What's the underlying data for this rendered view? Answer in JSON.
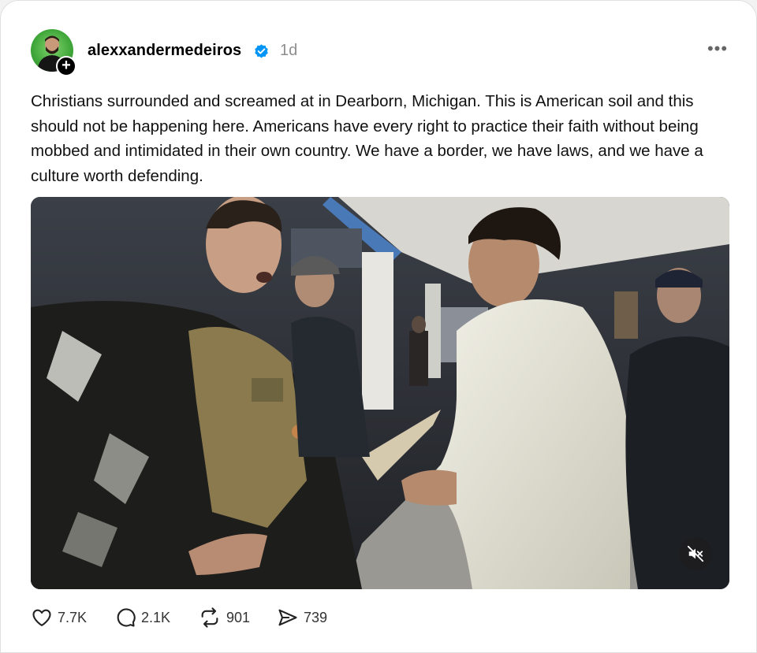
{
  "post": {
    "username": "alexxandermedeiros",
    "time": "1d",
    "more_label": "•••",
    "follow_label": "+",
    "text": "Christians surrounded and screamed at in Dearborn, Michigan. This is American soil and this should not be happening here. Americans have every right to practice their faith without being mobbed and intimidated in their own country. We have a border, we have laws, and we have a culture worth defending.",
    "verified": true
  },
  "stats": {
    "likes": "7.7K",
    "replies": "2.1K",
    "reposts": "901",
    "shares": "739"
  },
  "media": {
    "type": "video",
    "muted": true
  },
  "icons": {
    "like": "heart-icon",
    "reply": "comment-icon",
    "repost": "repost-icon",
    "share": "share-icon",
    "mute": "speaker-muted-icon",
    "verified": "verified-badge-icon",
    "more": "more-icon"
  },
  "colors": {
    "verified_blue": "#0095f6",
    "muted_text": "#8e8e8e",
    "avatar_green": "#3fa63a"
  }
}
